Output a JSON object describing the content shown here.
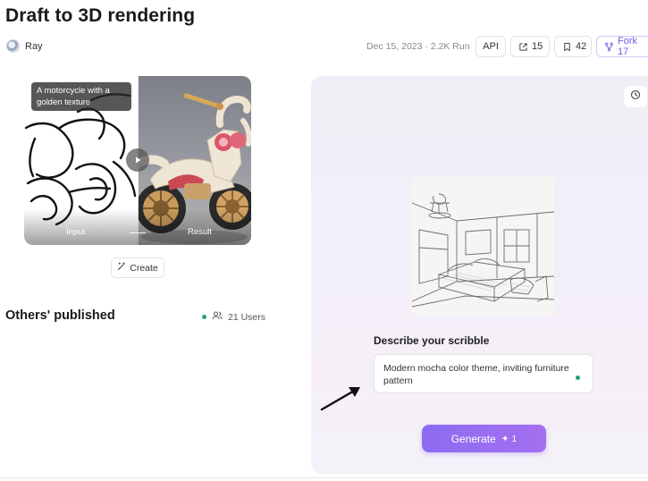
{
  "page": {
    "title": "Draft to 3D rendering"
  },
  "author": {
    "name": "Ray"
  },
  "meta": {
    "date_runs": "Dec 15, 2023 · 2.2K Run"
  },
  "actions": {
    "api_label": "API",
    "share_count": "15",
    "bookmark_count": "42",
    "fork_label": "Fork 17"
  },
  "demo": {
    "caption": "A motorcycle with a golden texture",
    "input_label": "Input",
    "result_label": "Result"
  },
  "create_button": {
    "label": "Create"
  },
  "others": {
    "title": "Others' published",
    "users": "21 Users"
  },
  "form": {
    "describe_label": "Describe your scribble",
    "prompt_value": "Modern mocha color theme, inviting furniture pattern",
    "generate_label": "Generate",
    "generate_cost": "1"
  },
  "colors": {
    "accent": "#8b6cf2",
    "status_green": "#1fa37b"
  },
  "icons": {
    "share": "share-icon",
    "bookmark": "bookmark-icon",
    "fork": "fork-icon",
    "history": "history-icon",
    "create": "magic-wand-icon",
    "users": "users-icon",
    "play": "play-icon",
    "spark": "spark-icon"
  }
}
